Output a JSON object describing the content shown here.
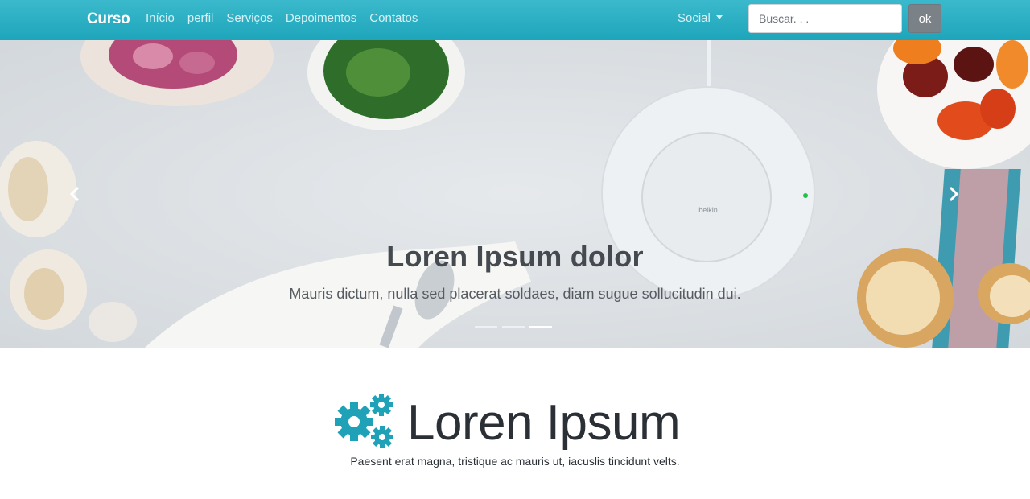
{
  "navbar": {
    "brand": "Curso",
    "links": [
      "Início",
      "perfil",
      "Serviços",
      "Depoimentos",
      "Contatos"
    ],
    "social_label": "Social",
    "search_placeholder": "Buscar. . .",
    "search_button": "ok"
  },
  "carousel": {
    "title": "Loren Ipsum dolor",
    "text": "Mauris dictum, nulla sed placerat soldaes, diam sugue sollucitudin dui.",
    "slides": 3,
    "active_slide": 3,
    "device_brand": "belkin"
  },
  "feature": {
    "icon": "gears-icon",
    "title": "Loren Ipsum",
    "text": "Paesent erat magna, tristique ac mauris ut, iacuslis tincidunt velts."
  },
  "colors": {
    "navbar": "#2fb1c4",
    "accent": "#1fa2b8",
    "button": "#7a8288"
  }
}
